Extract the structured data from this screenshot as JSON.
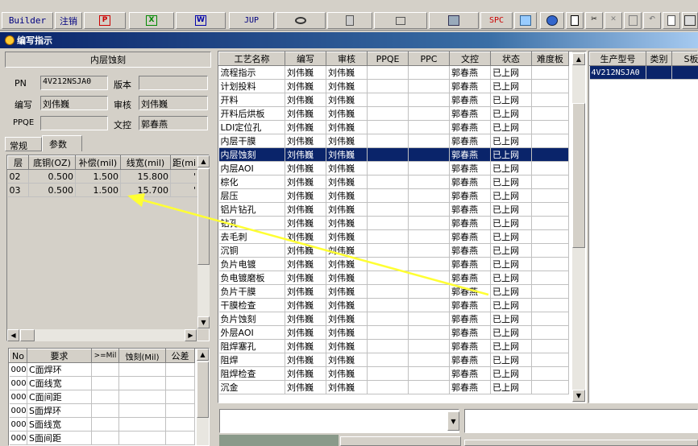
{
  "toolbar": {
    "builder_label": "Builder",
    "logout_label": "注销",
    "jup_label": "JUP",
    "spc_label": "SPC",
    "icons": [
      "ppt-icon",
      "excel-icon",
      "word-icon",
      "jup-icon",
      "eye-icon",
      "database-icon",
      "network-icon",
      "monitor-icon",
      "spc-icon",
      "calc-icon",
      "globe-icon",
      "new-doc-icon",
      "cut-icon",
      "close-x-icon",
      "save-icon",
      "undo-icon",
      "preview-icon",
      "print-icon"
    ]
  },
  "window": {
    "title": "编写指示"
  },
  "left": {
    "header": "内层蚀刻",
    "pn_label": "PN",
    "pn_value": "4V212NSJA0",
    "version_label": "版本",
    "version_value": "",
    "writer_label": "编写",
    "writer_value": "刘伟巍",
    "reviewer_label": "审核",
    "reviewer_value": "刘伟巍",
    "ppqe_label": "PPQE",
    "ppqe_value": "",
    "doc_label": "文控",
    "doc_value": "郭春燕",
    "tabs": [
      "常规",
      "参数"
    ],
    "params_table": {
      "columns": [
        "层",
        "底铜(OZ)",
        "补偿(mil)",
        "线宽(mil)",
        "距(mi"
      ],
      "rows": [
        [
          "02",
          "0.500",
          "1.500",
          "15.800",
          "'"
        ],
        [
          "03",
          "0.500",
          "1.500",
          "15.700",
          "'"
        ]
      ]
    },
    "req_table": {
      "columns": [
        "No",
        "要求",
        ">=Mil",
        "蚀刻(Mil)",
        "公差"
      ],
      "rows": [
        [
          "000",
          "C面焊环"
        ],
        [
          "000",
          "C面线宽"
        ],
        [
          "000",
          "C面间距"
        ],
        [
          "000",
          "S面焊环"
        ],
        [
          "000",
          "S面线宽"
        ],
        [
          "000",
          "S面间距"
        ]
      ]
    }
  },
  "process_table": {
    "columns": [
      "工艺名称",
      "编写",
      "审核",
      "PPQE",
      "PPC",
      "文控",
      "状态",
      "难度板"
    ],
    "rows": [
      [
        "流程指示",
        "刘伟巍",
        "刘伟巍",
        "",
        "",
        "郭春燕",
        "已上网",
        ""
      ],
      [
        "计划投料",
        "刘伟巍",
        "刘伟巍",
        "",
        "",
        "郭春燕",
        "已上网",
        ""
      ],
      [
        "开料",
        "刘伟巍",
        "刘伟巍",
        "",
        "",
        "郭春燕",
        "已上网",
        ""
      ],
      [
        "开料后烘板",
        "刘伟巍",
        "刘伟巍",
        "",
        "",
        "郭春燕",
        "已上网",
        ""
      ],
      [
        "LDI定位孔",
        "刘伟巍",
        "刘伟巍",
        "",
        "",
        "郭春燕",
        "已上网",
        ""
      ],
      [
        "内层干膜",
        "刘伟巍",
        "刘伟巍",
        "",
        "",
        "郭春燕",
        "已上网",
        ""
      ],
      [
        "内层蚀刻",
        "刘伟巍",
        "刘伟巍",
        "",
        "",
        "郭春燕",
        "已上网",
        ""
      ],
      [
        "内层AOI",
        "刘伟巍",
        "刘伟巍",
        "",
        "",
        "郭春燕",
        "已上网",
        ""
      ],
      [
        "棕化",
        "刘伟巍",
        "刘伟巍",
        "",
        "",
        "郭春燕",
        "已上网",
        ""
      ],
      [
        "层压",
        "刘伟巍",
        "刘伟巍",
        "",
        "",
        "郭春燕",
        "已上网",
        ""
      ],
      [
        "铝片钻孔",
        "刘伟巍",
        "刘伟巍",
        "",
        "",
        "郭春燕",
        "已上网",
        ""
      ],
      [
        "钻孔",
        "刘伟巍",
        "刘伟巍",
        "",
        "",
        "郭春燕",
        "已上网",
        ""
      ],
      [
        "去毛刺",
        "刘伟巍",
        "刘伟巍",
        "",
        "",
        "郭春燕",
        "已上网",
        ""
      ],
      [
        "沉铜",
        "刘伟巍",
        "刘伟巍",
        "",
        "",
        "郭春燕",
        "已上网",
        ""
      ],
      [
        "负片电镀",
        "刘伟巍",
        "刘伟巍",
        "",
        "",
        "郭春燕",
        "已上网",
        ""
      ],
      [
        "负电镀磨板",
        "刘伟巍",
        "刘伟巍",
        "",
        "",
        "郭春燕",
        "已上网",
        ""
      ],
      [
        "负片干膜",
        "刘伟巍",
        "刘伟巍",
        "",
        "",
        "郭春燕",
        "已上网",
        ""
      ],
      [
        "干膜检查",
        "刘伟巍",
        "刘伟巍",
        "",
        "",
        "郭春燕",
        "已上网",
        ""
      ],
      [
        "负片蚀刻",
        "刘伟巍",
        "刘伟巍",
        "",
        "",
        "郭春燕",
        "已上网",
        ""
      ],
      [
        "外层AOI",
        "刘伟巍",
        "刘伟巍",
        "",
        "",
        "郭春燕",
        "已上网",
        ""
      ],
      [
        "阻焊塞孔",
        "刘伟巍",
        "刘伟巍",
        "",
        "",
        "郭春燕",
        "已上网",
        ""
      ],
      [
        "阻焊",
        "刘伟巍",
        "刘伟巍",
        "",
        "",
        "郭春燕",
        "已上网",
        ""
      ],
      [
        "阻焊检查",
        "刘伟巍",
        "刘伟巍",
        "",
        "",
        "郭春燕",
        "已上网",
        ""
      ],
      [
        "沉金",
        "刘伟巍",
        "刘伟巍",
        "",
        "",
        "郭春燕",
        "已上网",
        ""
      ]
    ],
    "selected_index": 6
  },
  "right_table": {
    "columns": [
      "生产型号",
      "类别",
      "S板"
    ],
    "rows": [
      [
        "4V212NSJA0",
        "",
        ""
      ]
    ]
  },
  "colors": {
    "selection": "#0a246a",
    "arrow": "#ffff33",
    "title_start": "#0a246a"
  }
}
